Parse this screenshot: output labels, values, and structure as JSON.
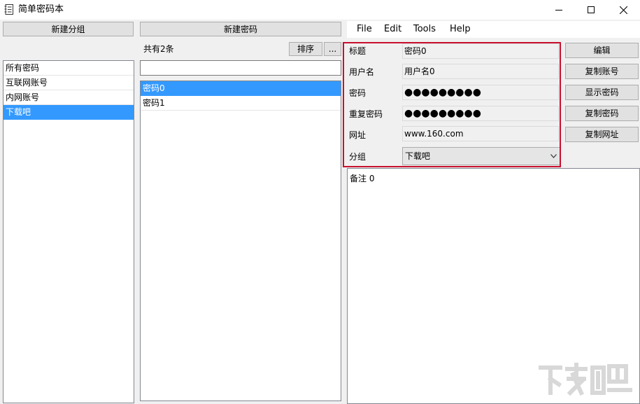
{
  "window": {
    "title": "简单密码本",
    "minimize_label": "minimize",
    "maximize_label": "maximize",
    "close_label": "close"
  },
  "groups_panel": {
    "new_group_label": "新建分组",
    "items": [
      {
        "label": "所有密码",
        "selected": false
      },
      {
        "label": "互联网账号",
        "selected": false
      },
      {
        "label": "内网账号",
        "selected": false
      },
      {
        "label": "下载吧",
        "selected": true
      }
    ]
  },
  "passwords_panel": {
    "new_password_label": "新建密码",
    "count_text": "共有2条",
    "sort_label": "排序",
    "more_label": "...",
    "search_value": "",
    "items": [
      {
        "label": "密码0",
        "selected": true
      },
      {
        "label": "密码1",
        "selected": false
      }
    ]
  },
  "menu": {
    "file": "File",
    "edit": "Edit",
    "tools": "Tools",
    "help": "Help"
  },
  "details": {
    "title_label": "标题",
    "title_value": "密码0",
    "username_label": "用户名",
    "username_value": "用户名0",
    "password_label": "密码",
    "password_value": "●●●●●●●●●",
    "repeat_label": "重复密码",
    "repeat_value": "●●●●●●●●●",
    "url_label": "网址",
    "url_value": "www.160.com",
    "group_label": "分组",
    "group_value": "下载吧",
    "notes_value": "备注 0"
  },
  "actions": {
    "edit_label": "编辑",
    "copy_account_label": "复制账号",
    "show_password_label": "显示密码",
    "copy_password_label": "复制密码",
    "copy_url_label": "复制网址"
  },
  "colors": {
    "selection": "#3399ff",
    "highlight_frame": "#c8102e"
  }
}
